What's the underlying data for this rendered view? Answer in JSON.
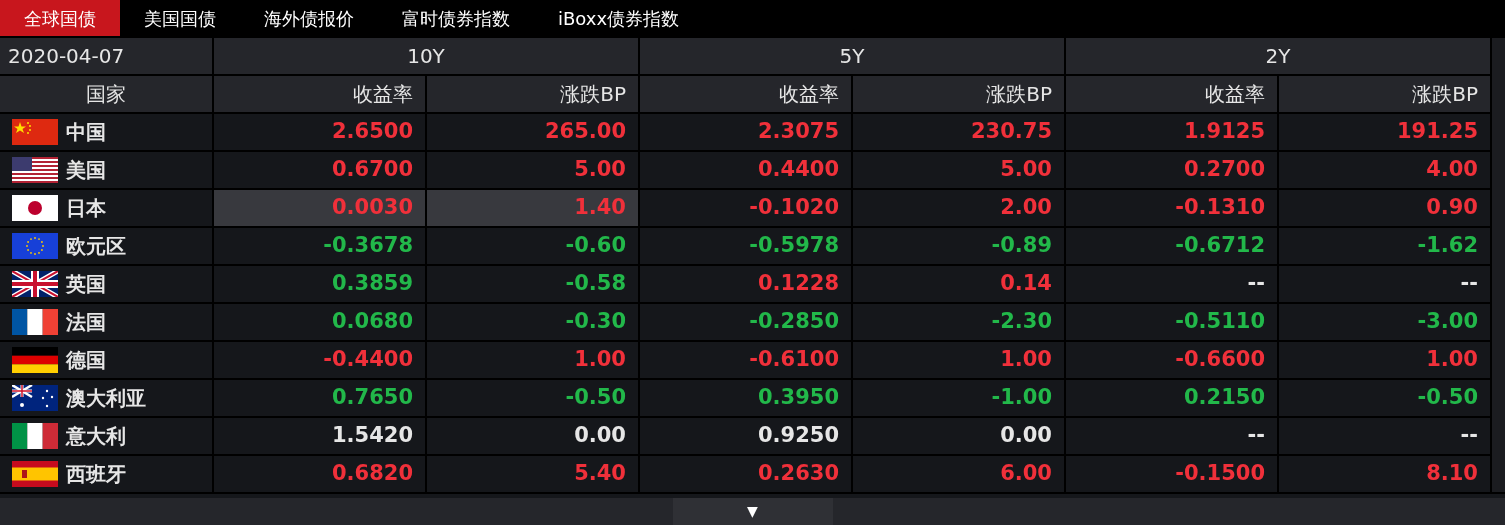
{
  "tabs": [
    {
      "label": "全球国债",
      "selected": true
    },
    {
      "label": "美国国债",
      "selected": false
    },
    {
      "label": "海外债报价",
      "selected": false
    },
    {
      "label": "富时债券指数",
      "selected": false
    },
    {
      "label": "iBoxx债券指数",
      "selected": false
    }
  ],
  "table": {
    "date": "2020-04-07",
    "groups": [
      "10Y",
      "5Y",
      "2Y"
    ],
    "country_header": "国家",
    "sub_columns": [
      "收益率",
      "涨跌BP",
      "收益率",
      "涨跌BP",
      "收益率",
      "涨跌BP"
    ],
    "rows": [
      {
        "country": "中国",
        "kind": "cn",
        "cells": [
          {
            "text": "2.6500",
            "color": "#f0303a",
            "highlighted": false
          },
          {
            "text": "265.00",
            "color": "#f0303a",
            "highlighted": false
          },
          {
            "text": "2.3075",
            "color": "#f0303a",
            "highlighted": false
          },
          {
            "text": "230.75",
            "color": "#f0303a",
            "highlighted": false
          },
          {
            "text": "1.9125",
            "color": "#f0303a",
            "highlighted": false
          },
          {
            "text": "191.25",
            "color": "#f0303a",
            "highlighted": false
          }
        ]
      },
      {
        "country": "美国",
        "kind": "us",
        "cells": [
          {
            "text": "0.6700",
            "color": "#f0303a",
            "highlighted": false
          },
          {
            "text": "5.00",
            "color": "#f0303a",
            "highlighted": false
          },
          {
            "text": "0.4400",
            "color": "#f0303a",
            "highlighted": false
          },
          {
            "text": "5.00",
            "color": "#f0303a",
            "highlighted": false
          },
          {
            "text": "0.2700",
            "color": "#f0303a",
            "highlighted": false
          },
          {
            "text": "4.00",
            "color": "#f0303a",
            "highlighted": false
          }
        ]
      },
      {
        "country": "日本",
        "kind": "jp",
        "cells": [
          {
            "text": "0.0030",
            "color": "#f0303a",
            "highlighted": true
          },
          {
            "text": "1.40",
            "color": "#f0303a",
            "highlighted": true
          },
          {
            "text": "-0.1020",
            "color": "#f0303a",
            "highlighted": false
          },
          {
            "text": "2.00",
            "color": "#f0303a",
            "highlighted": false
          },
          {
            "text": "-0.1310",
            "color": "#f0303a",
            "highlighted": false
          },
          {
            "text": "0.90",
            "color": "#f0303a",
            "highlighted": false
          }
        ]
      },
      {
        "country": "欧元区",
        "kind": "eu",
        "cells": [
          {
            "text": "-0.3678",
            "color": "#22b84a",
            "highlighted": false
          },
          {
            "text": "-0.60",
            "color": "#22b84a",
            "highlighted": false
          },
          {
            "text": "-0.5978",
            "color": "#22b84a",
            "highlighted": false
          },
          {
            "text": "-0.89",
            "color": "#22b84a",
            "highlighted": false
          },
          {
            "text": "-0.6712",
            "color": "#22b84a",
            "highlighted": false
          },
          {
            "text": "-1.62",
            "color": "#22b84a",
            "highlighted": false
          }
        ]
      },
      {
        "country": "英国",
        "kind": "gb",
        "cells": [
          {
            "text": "0.3859",
            "color": "#22b84a",
            "highlighted": false
          },
          {
            "text": "-0.58",
            "color": "#22b84a",
            "highlighted": false
          },
          {
            "text": "0.1228",
            "color": "#f0303a",
            "highlighted": false
          },
          {
            "text": "0.14",
            "color": "#f0303a",
            "highlighted": false
          },
          {
            "text": "--",
            "color": "#e6e6e6",
            "highlighted": false
          },
          {
            "text": "--",
            "color": "#e6e6e6",
            "highlighted": false
          }
        ]
      },
      {
        "country": "法国",
        "kind": "fr",
        "cells": [
          {
            "text": "0.0680",
            "color": "#22b84a",
            "highlighted": false
          },
          {
            "text": "-0.30",
            "color": "#22b84a",
            "highlighted": false
          },
          {
            "text": "-0.2850",
            "color": "#22b84a",
            "highlighted": false
          },
          {
            "text": "-2.30",
            "color": "#22b84a",
            "highlighted": false
          },
          {
            "text": "-0.5110",
            "color": "#22b84a",
            "highlighted": false
          },
          {
            "text": "-3.00",
            "color": "#22b84a",
            "highlighted": false
          }
        ]
      },
      {
        "country": "德国",
        "kind": "de",
        "cells": [
          {
            "text": "-0.4400",
            "color": "#f0303a",
            "highlighted": false
          },
          {
            "text": "1.00",
            "color": "#f0303a",
            "highlighted": false
          },
          {
            "text": "-0.6100",
            "color": "#f0303a",
            "highlighted": false
          },
          {
            "text": "1.00",
            "color": "#f0303a",
            "highlighted": false
          },
          {
            "text": "-0.6600",
            "color": "#f0303a",
            "highlighted": false
          },
          {
            "text": "1.00",
            "color": "#f0303a",
            "highlighted": false
          }
        ]
      },
      {
        "country": "澳大利亚",
        "kind": "au",
        "cells": [
          {
            "text": "0.7650",
            "color": "#22b84a",
            "highlighted": false
          },
          {
            "text": "-0.50",
            "color": "#22b84a",
            "highlighted": false
          },
          {
            "text": "0.3950",
            "color": "#22b84a",
            "highlighted": false
          },
          {
            "text": "-1.00",
            "color": "#22b84a",
            "highlighted": false
          },
          {
            "text": "0.2150",
            "color": "#22b84a",
            "highlighted": false
          },
          {
            "text": "-0.50",
            "color": "#22b84a",
            "highlighted": false
          }
        ]
      },
      {
        "country": "意大利",
        "kind": "it",
        "cells": [
          {
            "text": "1.5420",
            "color": "#e6e6e6",
            "highlighted": false
          },
          {
            "text": "0.00",
            "color": "#e6e6e6",
            "highlighted": false
          },
          {
            "text": "0.9250",
            "color": "#e6e6e6",
            "highlighted": false
          },
          {
            "text": "0.00",
            "color": "#e6e6e6",
            "highlighted": false
          },
          {
            "text": "--",
            "color": "#e6e6e6",
            "highlighted": false
          },
          {
            "text": "--",
            "color": "#e6e6e6",
            "highlighted": false
          }
        ]
      },
      {
        "country": "西班牙",
        "kind": "es",
        "cells": [
          {
            "text": "0.6820",
            "color": "#f0303a",
            "highlighted": false
          },
          {
            "text": "5.40",
            "color": "#f0303a",
            "highlighted": false
          },
          {
            "text": "0.2630",
            "color": "#f0303a",
            "highlighted": false
          },
          {
            "text": "6.00",
            "color": "#f0303a",
            "highlighted": false
          },
          {
            "text": "-0.1500",
            "color": "#f0303a",
            "highlighted": false
          },
          {
            "text": "8.10",
            "color": "#f0303a",
            "highlighted": false
          }
        ]
      }
    ]
  },
  "scroll_down": "▼"
}
